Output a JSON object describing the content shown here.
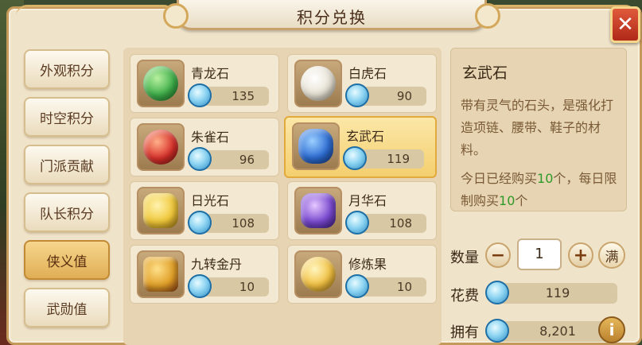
{
  "title": "积分兑换",
  "close_label": "✕",
  "tabs": [
    {
      "label": "外观积分",
      "active": false
    },
    {
      "label": "时空积分",
      "active": false
    },
    {
      "label": "门派贡献",
      "active": false
    },
    {
      "label": "队长积分",
      "active": false
    },
    {
      "label": "侠义值",
      "active": true
    },
    {
      "label": "武勋值",
      "active": false
    }
  ],
  "currency_icon": "blue-orb-coin-icon",
  "items": [
    {
      "name": "青龙石",
      "price": "135",
      "icon": "green-dragon-stone-icon",
      "color": "#3fb04a"
    },
    {
      "name": "白虎石",
      "price": "90",
      "icon": "white-tiger-stone-icon",
      "color": "#e8e2d4"
    },
    {
      "name": "朱雀石",
      "price": "96",
      "icon": "red-bird-stone-icon",
      "color": "#d8302a"
    },
    {
      "name": "玄武石",
      "price": "119",
      "icon": "black-tortoise-stone-icon",
      "color": "#2f6ed4",
      "selected": true
    },
    {
      "name": "日光石",
      "price": "108",
      "icon": "sunlight-stone-icon",
      "color": "#f0c83a"
    },
    {
      "name": "月华石",
      "price": "108",
      "icon": "moonlight-stone-icon",
      "color": "#7a4ad0"
    },
    {
      "name": "九转金丹",
      "price": "10",
      "icon": "golden-elixir-chest-icon",
      "color": "#e0a028"
    },
    {
      "name": "修炼果",
      "price": "10",
      "icon": "cultivation-fruit-icon",
      "color": "#f2c040"
    }
  ],
  "detail": {
    "name": "玄武石",
    "description": "带有灵气的石头，是强化打造项链、腰带、鞋子的材料。",
    "limit_prefix": "今日已经购买",
    "limit_bought": "10",
    "limit_mid": "个，每日限制购买",
    "limit_max": "10",
    "limit_suffix": "个"
  },
  "quantity": {
    "label": "数量",
    "minus": "−",
    "value": "1",
    "plus": "+",
    "max_label": "满"
  },
  "cost": {
    "label": "花费",
    "value": "119"
  },
  "owned": {
    "label": "拥有",
    "value": "8,201"
  },
  "info_label": "i"
}
